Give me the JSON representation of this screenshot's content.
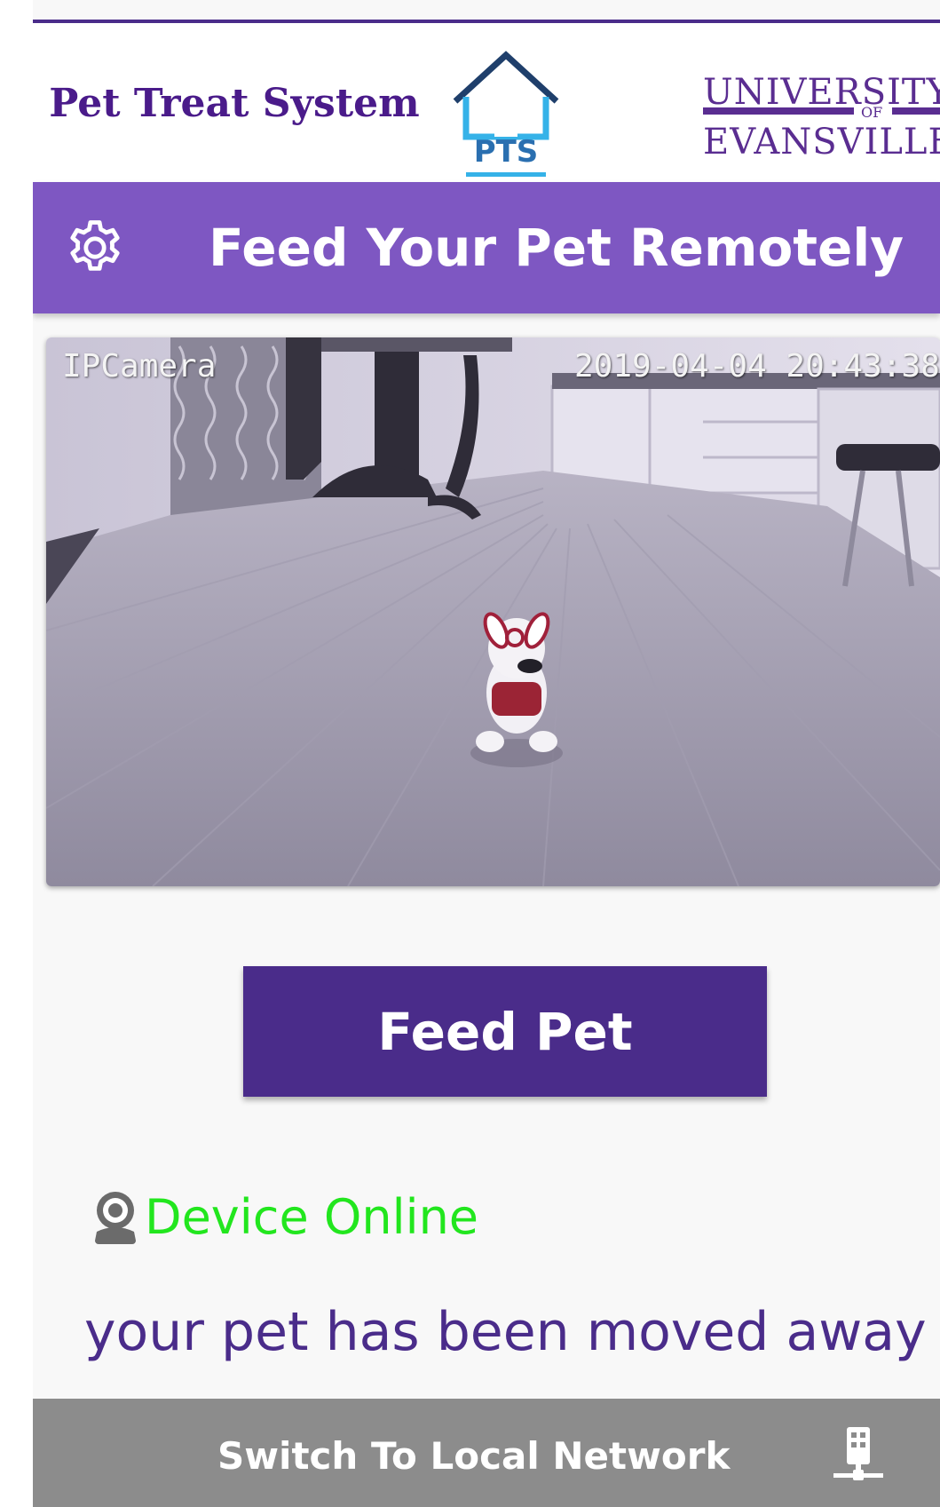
{
  "header": {
    "brand_title": "Pet Treat System",
    "pts_logo_text": "PTS",
    "university_line1": "UNIVERSITY",
    "university_of": "OF",
    "university_line2": "EVANSVILLE"
  },
  "titlebar": {
    "icon": "gear-icon",
    "title": "Feed Your Pet Remotely"
  },
  "camera": {
    "label": "IPCamera",
    "timestamp": "2019-04-04 20:43:38"
  },
  "feed_button": {
    "label": "Feed Pet"
  },
  "status": {
    "icon": "webcam-icon",
    "text": "Device Online",
    "color": "#22e61e"
  },
  "message": "your pet has been moved away",
  "bottombar": {
    "label": "Switch To Local Network",
    "icon": "network-icon"
  },
  "colors": {
    "primary": "#4a2c8a",
    "accent": "#7e57c2",
    "bottom_bar": "#8c8c8c"
  }
}
